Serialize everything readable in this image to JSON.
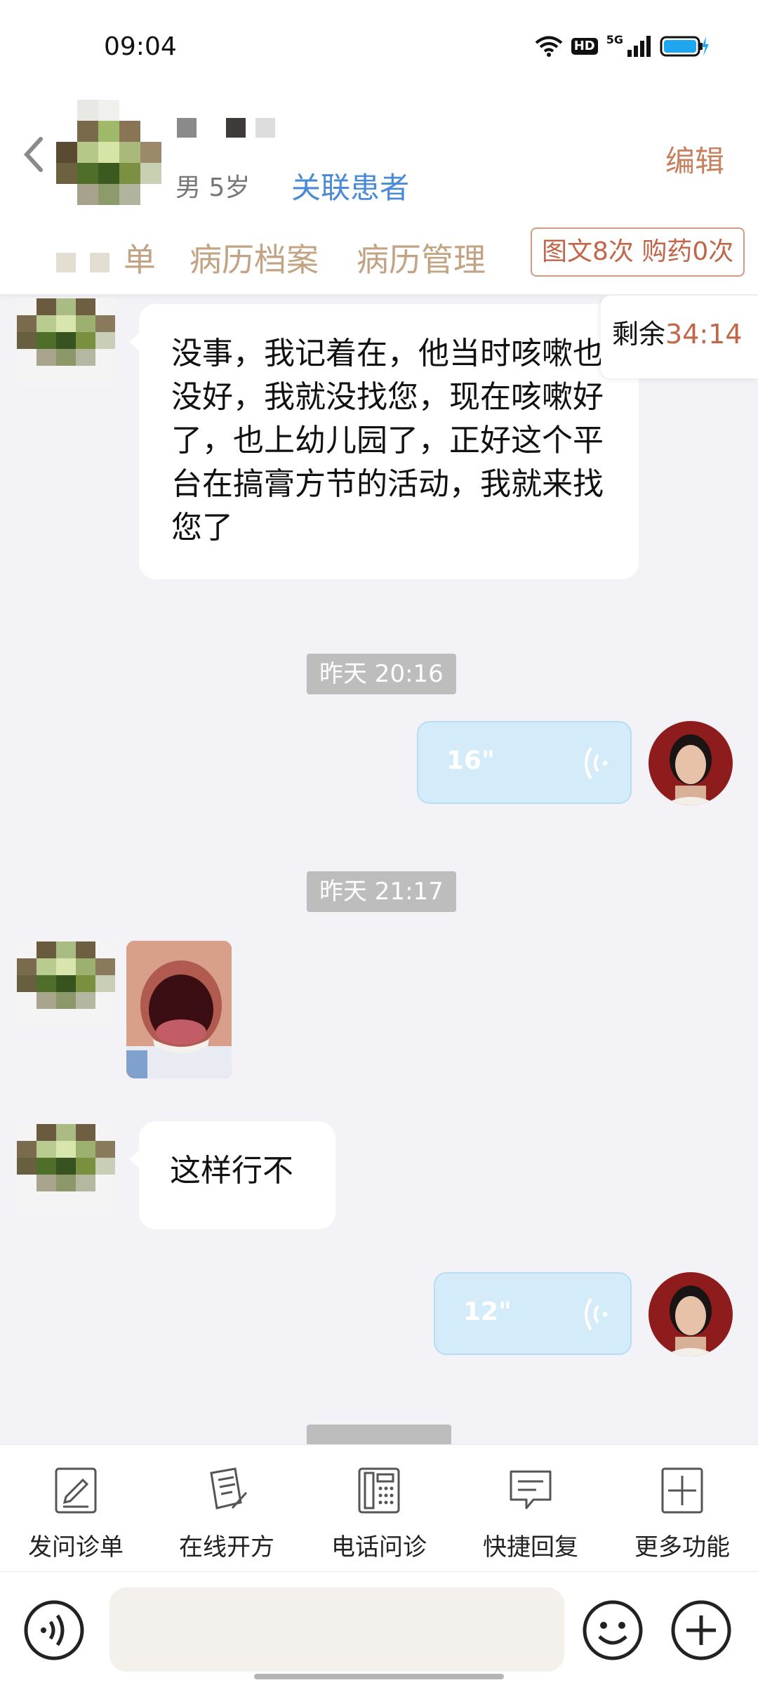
{
  "status_bar": {
    "time": "09:04",
    "hd": "HD",
    "network": "5G",
    "battery_color": "#1fa6f0"
  },
  "header": {
    "back_icon": "chevron-left-icon",
    "patient_info": "男 5岁",
    "link_patient": "关联患者",
    "edit": "编辑",
    "tabs": [
      "单",
      "病历档案",
      "病历管理"
    ],
    "quota": "图文8次 购药0次"
  },
  "timer": {
    "prefix": "剩余",
    "value": "34:14"
  },
  "messages": [
    {
      "from": "patient",
      "type": "text",
      "text": "没事，我记着在，他当时咳嗽也没好，我就没找您，现在咳嗽好了，也上幼儿园了，正好这个平台在搞膏方节的活动，我就来找您了"
    },
    {
      "type": "time",
      "text": "昨天 20:16"
    },
    {
      "from": "doctor",
      "type": "voice",
      "duration": "16\""
    },
    {
      "type": "time",
      "text": "昨天 21:17"
    },
    {
      "from": "patient",
      "type": "image"
    },
    {
      "from": "patient",
      "type": "text",
      "text": "这样行不"
    },
    {
      "from": "doctor",
      "type": "voice",
      "duration": "12\""
    }
  ],
  "toolbar": [
    {
      "icon": "form-pen-icon",
      "label": "发问诊单"
    },
    {
      "icon": "prescription-icon",
      "label": "在线开方"
    },
    {
      "icon": "phone-keypad-icon",
      "label": "电话问诊"
    },
    {
      "icon": "chat-bubble-icon",
      "label": "快捷回复"
    },
    {
      "icon": "plus-square-icon",
      "label": "更多功能"
    }
  ],
  "input_bar": {
    "voice_icon": "voice-toggle-icon",
    "emoji_icon": "emoji-icon",
    "plus_icon": "plus-circle-icon"
  },
  "colors": {
    "accent": "#c6805d",
    "link": "#4a8ad6",
    "tab": "#c2a383",
    "voice_bubble": "#d4ecfa"
  }
}
